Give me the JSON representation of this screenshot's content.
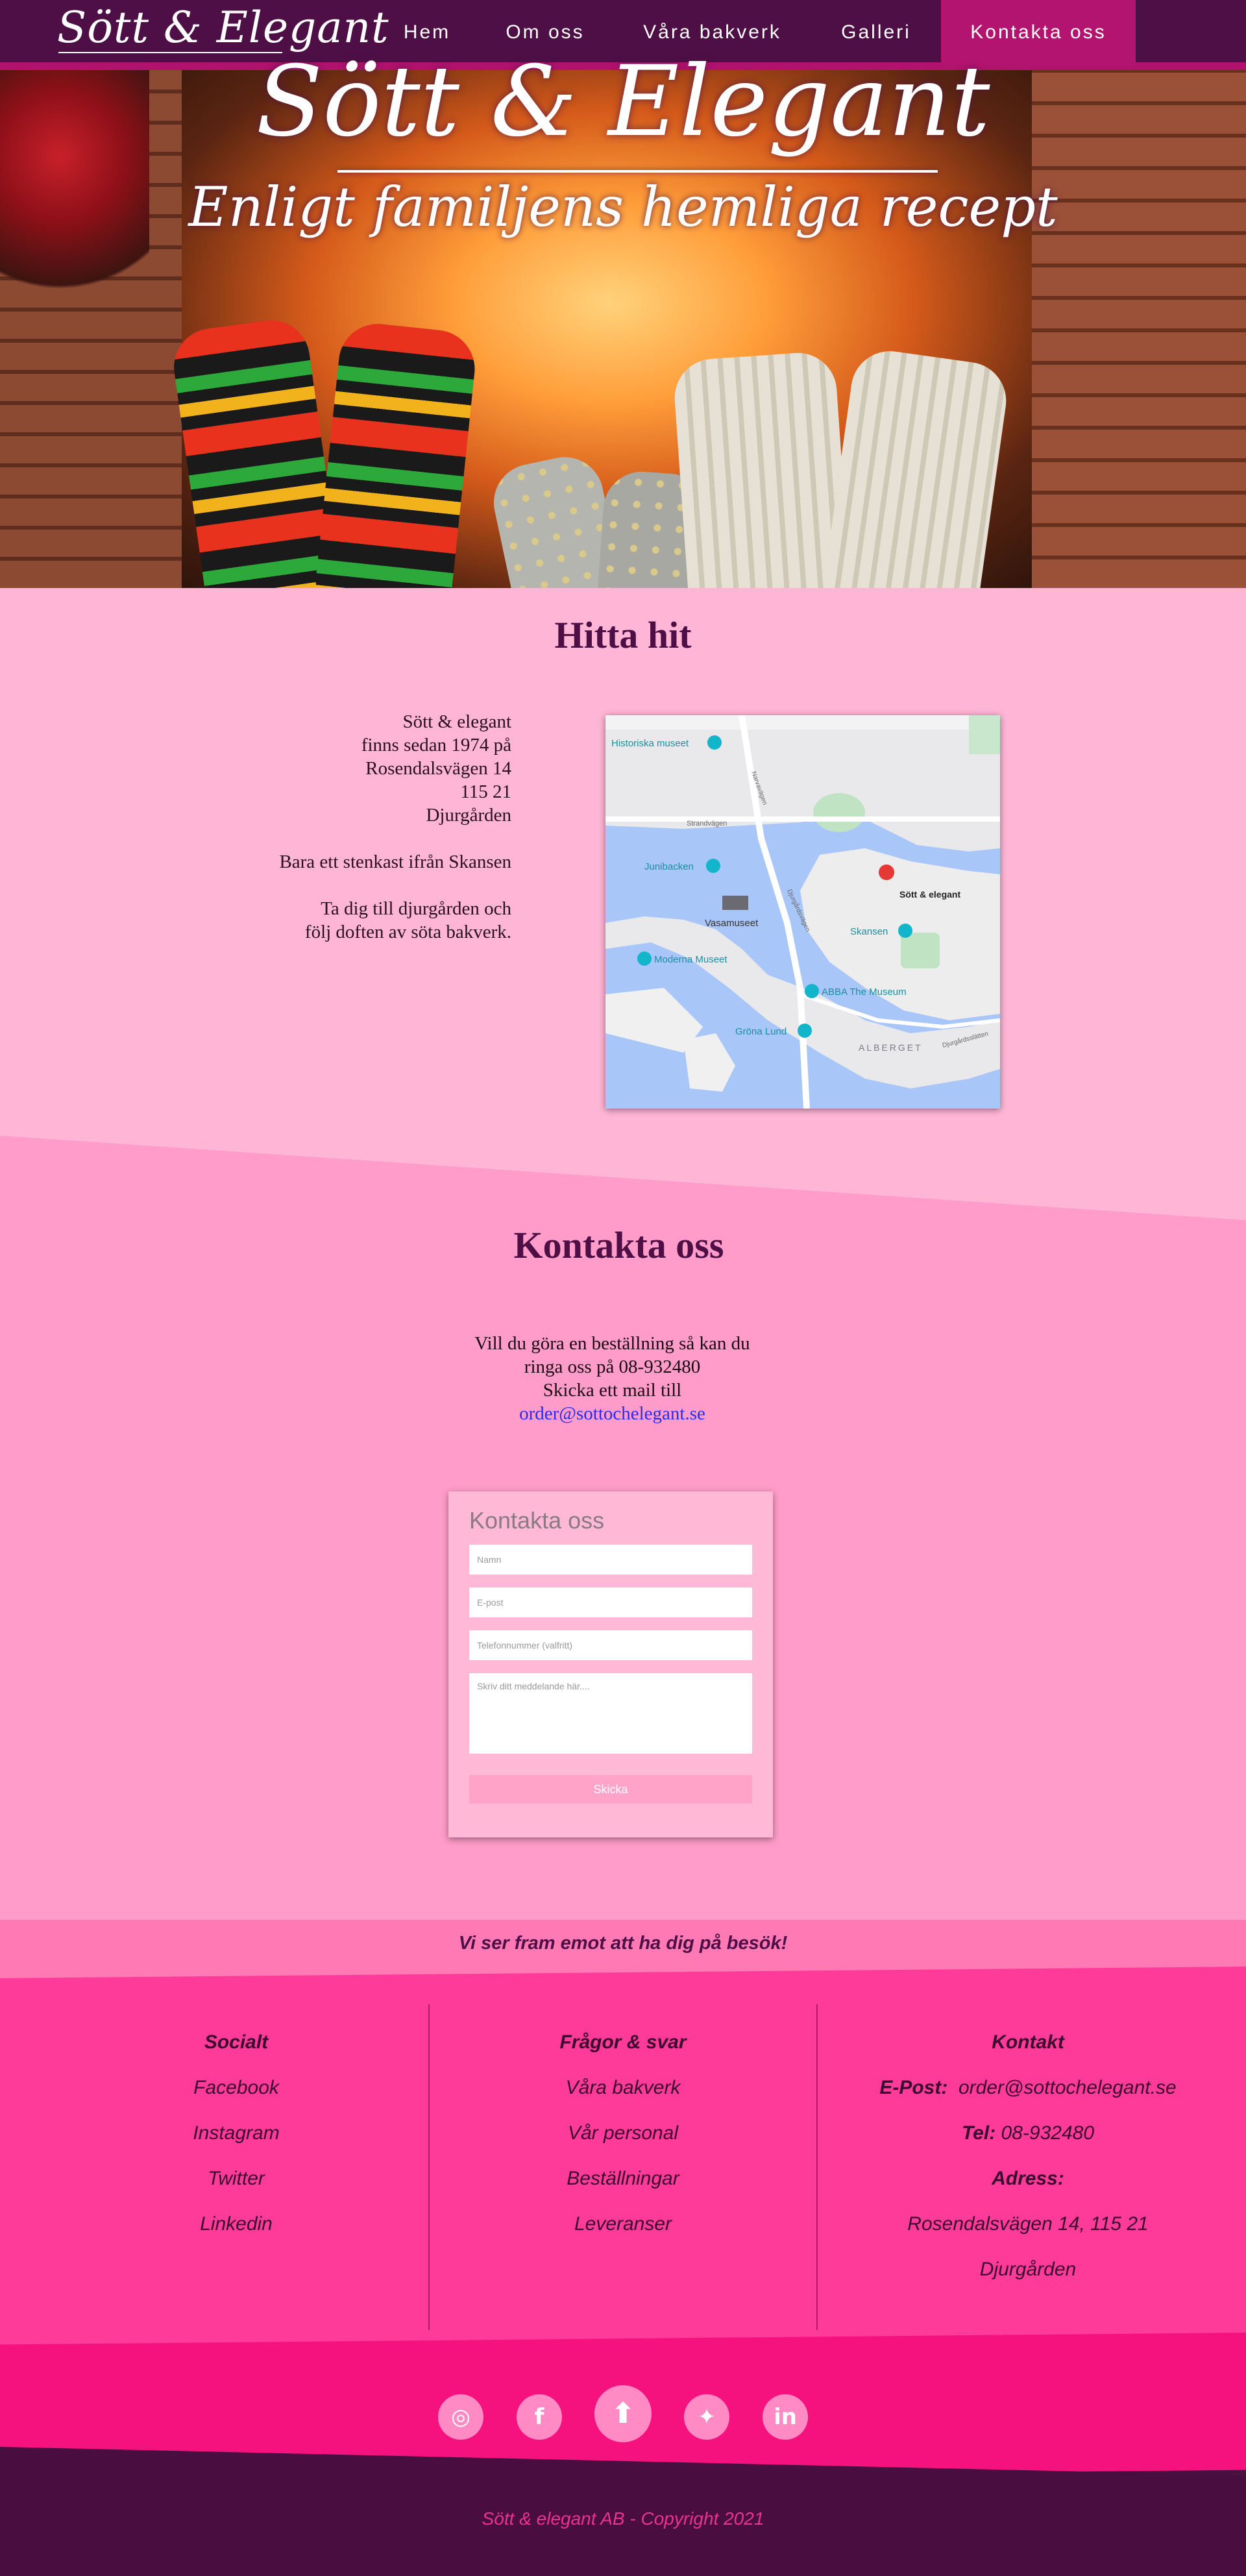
{
  "nav": {
    "logo": "Sött & Elegant",
    "items": [
      "Hem",
      "Om oss",
      "Våra bakverk",
      "Galleri",
      "Kontakta oss"
    ]
  },
  "hero": {
    "title": "Sött & Elegant",
    "subtitle": "Enligt familjens hemliga recept"
  },
  "hitta": {
    "title": "Hitta hit",
    "lines": [
      "Sött & elegant",
      "finns sedan 1974 på",
      "Rosendalsvägen 14",
      "115 21",
      "Djurgården",
      "",
      "Bara ett stenkast ifrån Skansen",
      "",
      "Ta dig till djurgården och",
      "följ doften av söta bakverk."
    ],
    "map_labels": {
      "historiska": "Historiska museet",
      "narvavagen": "Narvavägen",
      "strandvagen": "Strandvägen",
      "junibacken": "Junibacken",
      "vasamuseet": "Vasamuseet",
      "djurgardsvagen": "Djurgårdsvägen",
      "sott": "Sött & elegant",
      "skansen": "Skansen",
      "moderna": "Moderna Museet",
      "abba": "ABBA The Museum",
      "grona": "Gröna Lund",
      "alberget": "ALBERGET",
      "djurgardsslatten": "Djurgårdsslätten"
    }
  },
  "kontakt": {
    "title": "Kontakta oss",
    "line1": "Vill du göra en beställning så kan du",
    "line2": "ringa oss på 08-932480",
    "line3": "Skicka ett mail till",
    "email": "order@sottochelegant.se"
  },
  "form": {
    "title": "Kontakta oss",
    "name_placeholder": "Namn",
    "email_placeholder": "E-post",
    "phone_placeholder": "Telefonnummer (valfritt)",
    "message_placeholder": "Skriv ditt meddelande här....",
    "send_label": "Skicka"
  },
  "footer": {
    "tagline": "Vi ser fram emot att ha dig på besök!",
    "social": {
      "heading": "Socialt",
      "items": [
        "Facebook",
        "Instagram",
        "Twitter",
        "Linkedin"
      ]
    },
    "faq": {
      "heading": "Frågor & svar",
      "items": [
        "Våra bakverk",
        "Vår personal",
        "Beställningar",
        "Leveranser"
      ]
    },
    "contact": {
      "heading": "Kontakt",
      "email_label": "E-Post:",
      "email": "order@sottochelegant.se",
      "tel_label": "Tel:",
      "tel": "08-932480",
      "address_label": "Adress:",
      "address_line1": "Rosendalsvägen 14, 115 21",
      "address_line2": "Djurgården"
    },
    "social_icons": [
      "instagram-icon",
      "facebook-icon",
      "arrow-up-icon",
      "twitter-icon",
      "linkedin-icon"
    ],
    "copyright": "Sött & elegant AB - Copyright 2021"
  },
  "colors": {
    "nav": "#4d0f45",
    "accent": "#b2146f",
    "hitta_bg": "#ffb6d6",
    "kontakt_bg": "#ff9cc9",
    "footer_bg": "#ff3b99",
    "social_band": "#f5127f",
    "bottom": "#4a0d3f"
  }
}
